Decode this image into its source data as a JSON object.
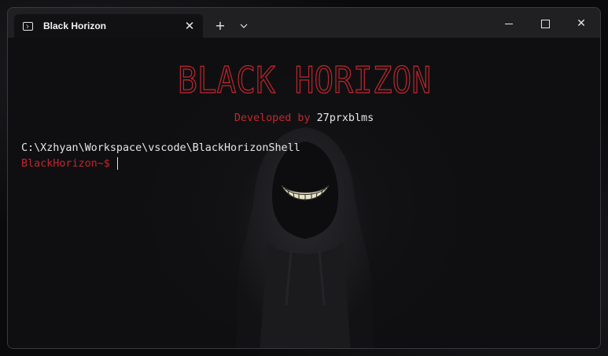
{
  "window": {
    "tab_title": "Black Horizon",
    "tab_icon": "terminal-icon",
    "new_tab_glyph": "+",
    "dropdown_glyph": "⌵",
    "close_tab_glyph": "✕",
    "close_window_glyph": "✕"
  },
  "terminal": {
    "banner_text": "BLACK HORIZON",
    "developed_prefix": "Developed by ",
    "developer_name": "27prxblms",
    "cwd": "C:\\Xzhyan\\Workspace\\vscode\\BlackHorizonShell",
    "prompt": "BlackHorizon~$"
  },
  "colors": {
    "accent_red": "#c0272d",
    "text": "#e6e6e6",
    "background": "#0f0f11",
    "titlebar": "#202022"
  }
}
